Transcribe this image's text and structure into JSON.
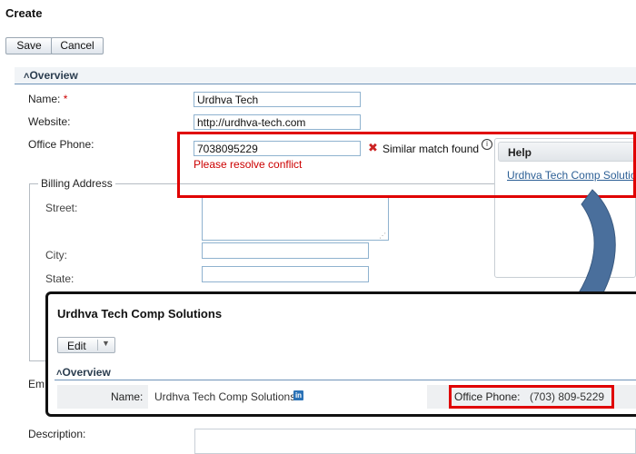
{
  "page": {
    "title": "Create"
  },
  "toolbar": {
    "save_label": "Save",
    "cancel_label": "Cancel"
  },
  "overview": {
    "header": "Overview",
    "name_label": "Name:",
    "required_mark": "*",
    "name_value": "Urdhva Tech",
    "website_label": "Website:",
    "website_value": "http://urdhva-tech.com",
    "phone_label": "Office Phone:",
    "phone_value": "7038095229",
    "conflict_error": "Please resolve conflict",
    "similar_match": "Similar match found",
    "email_label_partial": "Em",
    "description_label": "Description:"
  },
  "billing": {
    "legend": "Billing Address",
    "street_label": "Street:",
    "city_label": "City:",
    "state_label": "State:"
  },
  "help": {
    "header": "Help",
    "link": "Urdhva Tech Comp Solutions"
  },
  "popup": {
    "title": "Urdhva Tech Comp Solutions",
    "edit_label": "Edit",
    "overview_header": "Overview",
    "name_label": "Name:",
    "name_value": "Urdhva Tech Comp Solutions",
    "phone_label": "Office Phone:",
    "phone_value": "(703) 809-5229"
  },
  "colors": {
    "highlight_box": "#e00000",
    "arrow": "#4a6f9c",
    "link": "#2c5f95",
    "error": "#cc0000"
  }
}
